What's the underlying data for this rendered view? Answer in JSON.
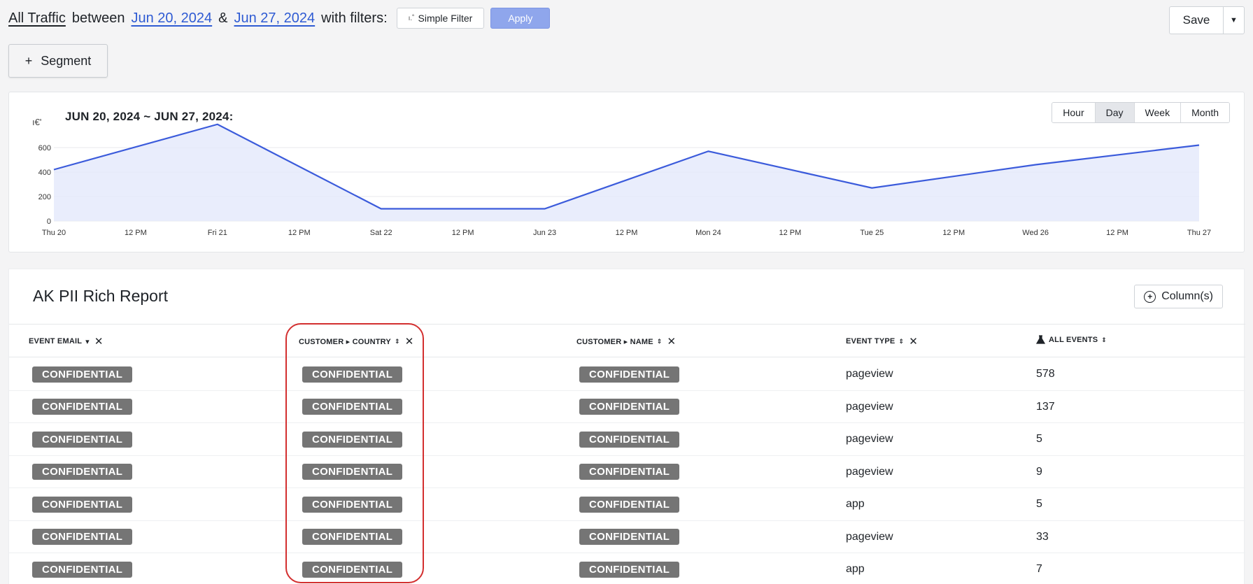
{
  "header": {
    "traffic_label": "All Traffic",
    "between_text": "between",
    "start_date": "Jun 20, 2024",
    "amp_text": "&",
    "end_date": "Jun 27, 2024",
    "filters_text": "with filters:",
    "simple_filter_label": "Simple Filter",
    "simple_filter_icon": "filter-icon",
    "apply_label": "Apply",
    "save_label": "Save",
    "segment_label": "Segment"
  },
  "chart_panel": {
    "title": "JUN 20, 2024 ~ JUN 27, 2024:",
    "symbol": "ı€'",
    "granularity": [
      "Hour",
      "Day",
      "Week",
      "Month"
    ],
    "active_granularity": "Day",
    "colors": {
      "line": "#3b5bdb",
      "fill": "#e3e8fb"
    }
  },
  "chart_data": {
    "type": "area",
    "x": [
      "Thu 20",
      "Fri 21",
      "Sat 22",
      "Jun 23",
      "Mon 24",
      "Tue 25",
      "Wed 26",
      "Thu 27"
    ],
    "values": [
      420,
      790,
      100,
      100,
      570,
      270,
      460,
      620
    ],
    "x_tick_labels": [
      "Thu 20",
      "12 PM",
      "Fri 21",
      "12 PM",
      "Sat 22",
      "12 PM",
      "Jun 23",
      "12 PM",
      "Mon 24",
      "12 PM",
      "Tue 25",
      "12 PM",
      "Wed 26",
      "12 PM",
      "Thu 27"
    ],
    "y_ticks": [
      0,
      200,
      400,
      600
    ],
    "ylim": [
      0,
      800
    ],
    "grid": true
  },
  "report": {
    "title": "AK PII Rich Report",
    "columns_button": "Column(s)",
    "headers": [
      {
        "label": "EVENT EMAIL",
        "indicator": "▾"
      },
      {
        "label": "CUSTOMER ▸ COUNTRY",
        "indicator": "⇕"
      },
      {
        "label": "CUSTOMER ▸ NAME",
        "indicator": "⇕"
      },
      {
        "label": "EVENT TYPE",
        "indicator": "⇕"
      },
      {
        "label": "ALL EVENTS",
        "indicator": "⇕"
      }
    ],
    "remove_mark": "✕",
    "all_events_icon": "flask-icon",
    "rows": [
      {
        "email": "CONFIDENTIAL",
        "country": "CONFIDENTIAL",
        "name": "CONFIDENTIAL",
        "event_type": "pageview",
        "all_events": "578"
      },
      {
        "email": "CONFIDENTIAL",
        "country": "CONFIDENTIAL",
        "name": "CONFIDENTIAL",
        "event_type": "pageview",
        "all_events": "137"
      },
      {
        "email": "CONFIDENTIAL",
        "country": "CONFIDENTIAL",
        "name": "CONFIDENTIAL",
        "event_type": "pageview",
        "all_events": "5"
      },
      {
        "email": "CONFIDENTIAL",
        "country": "CONFIDENTIAL",
        "name": "CONFIDENTIAL",
        "event_type": "pageview",
        "all_events": "9"
      },
      {
        "email": "CONFIDENTIAL",
        "country": "CONFIDENTIAL",
        "name": "CONFIDENTIAL",
        "event_type": "app",
        "all_events": "5"
      },
      {
        "email": "CONFIDENTIAL",
        "country": "CONFIDENTIAL",
        "name": "CONFIDENTIAL",
        "event_type": "pageview",
        "all_events": "33"
      },
      {
        "email": "CONFIDENTIAL",
        "country": "CONFIDENTIAL",
        "name": "CONFIDENTIAL",
        "event_type": "app",
        "all_events": "7"
      }
    ]
  }
}
